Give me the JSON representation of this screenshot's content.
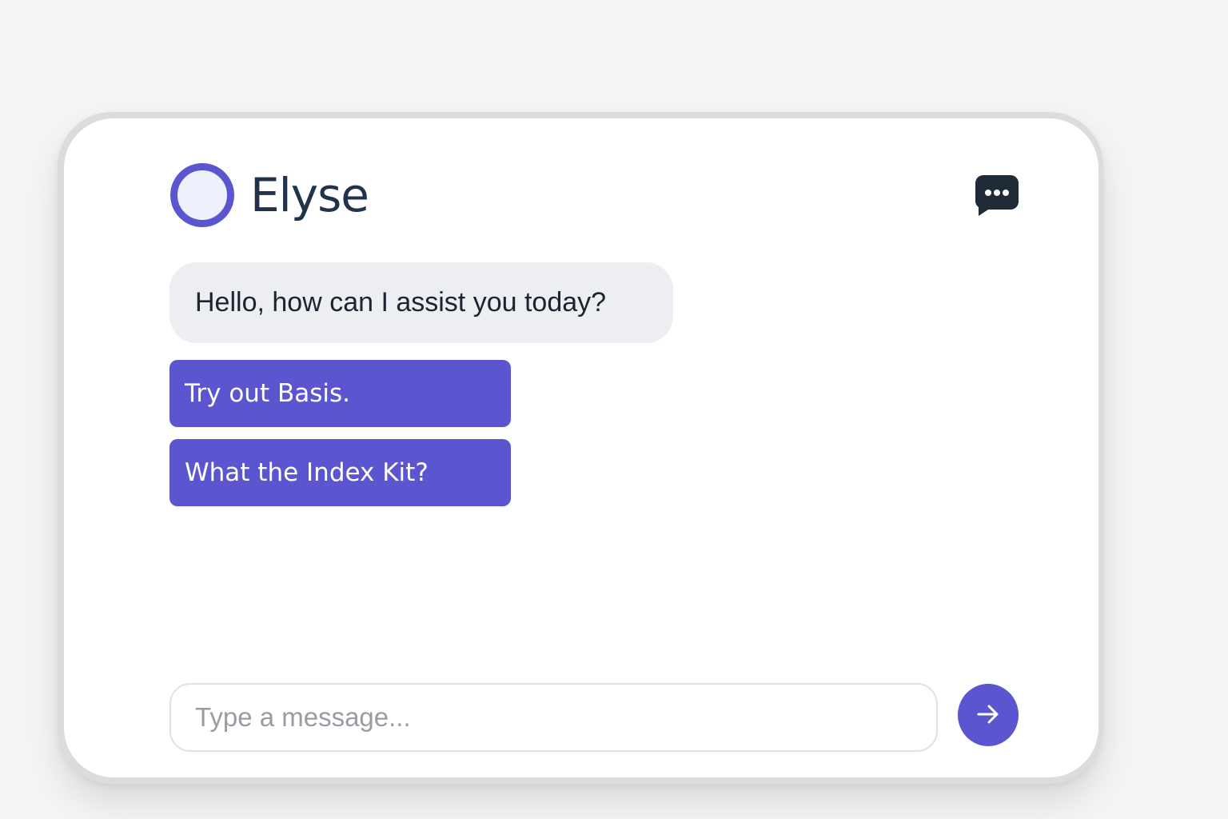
{
  "app": {
    "name": "Elyse"
  },
  "header": {
    "chat_icon": "chat-bubble-ellipsis-icon"
  },
  "conversation": {
    "assistant_message": "Hello, how can I assist you today?",
    "suggestions": [
      {
        "label": "Try out Basis."
      },
      {
        "label": "What the Index Kit?"
      }
    ]
  },
  "composer": {
    "placeholder": "Type a message...",
    "value": "",
    "send_icon": "arrow-right-icon"
  },
  "colors": {
    "accent": "#5b55d0",
    "brand_text": "#22324a",
    "bubble_bg": "#eceef1",
    "background": "#f4f4f5"
  }
}
